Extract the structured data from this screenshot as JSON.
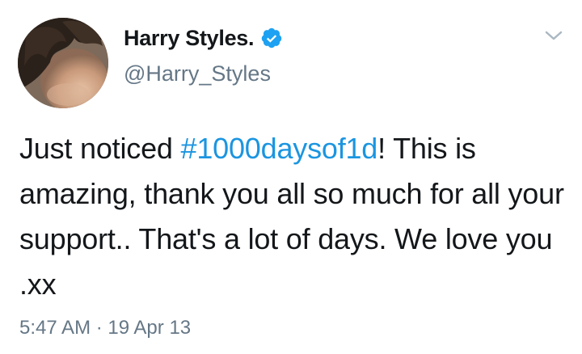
{
  "author": {
    "display_name": "Harry Styles.",
    "handle": "@Harry_Styles",
    "verified_icon": "verified-badge-icon",
    "avatar": "profile-photo"
  },
  "menu": {
    "icon": "chevron-down-icon"
  },
  "tweet": {
    "text_before": "Just noticed ",
    "hashtag": "#1000daysof1d",
    "text_after": "! This is amazing, thank you all so much for all your support.. That's a lot of days. We love you .xx"
  },
  "meta": {
    "timestamp": "5:47 AM · 19 Apr 13"
  },
  "colors": {
    "link": "#1b95e0",
    "secondary_text": "#657786",
    "primary_text": "#14171a",
    "verified": "#1da1f2"
  }
}
